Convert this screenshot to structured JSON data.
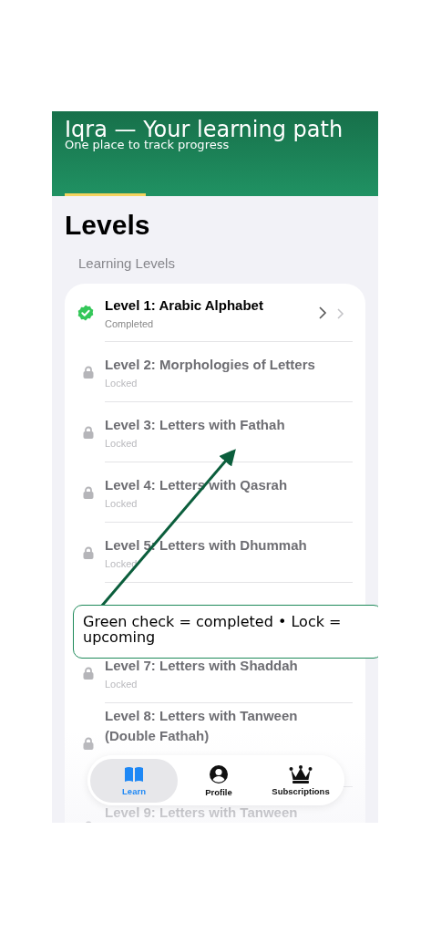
{
  "header": {
    "title": "Iqra — Your learning path",
    "subtitle": "One place to track progress"
  },
  "heading": "Levels",
  "section_label": "Learning Levels",
  "levels": [
    {
      "kind": "completed",
      "title": "Level 1: Arabic Alphabet",
      "status": "Completed"
    },
    {
      "kind": "locked",
      "title": "Level 2: Morphologies of Letters",
      "status": "Locked"
    },
    {
      "kind": "locked",
      "title": "Level 3: Letters with Fathah",
      "status": "Locked"
    },
    {
      "kind": "locked",
      "title": "Level 4: Letters with Qasrah",
      "status": "Locked"
    },
    {
      "kind": "locked",
      "title": "Level 5: Letters with Dhummah",
      "status": "Locked"
    },
    {
      "kind": "covered"
    },
    {
      "kind": "locked",
      "title": "Level 7: Letters with Shaddah",
      "status": "Locked"
    },
    {
      "kind": "locked",
      "title": "Level 8: Letters with Tanween (Double Fathah)"
    },
    {
      "kind": "locked",
      "title": "Level 9: Letters with Tanween"
    }
  ],
  "tab_bar": [
    {
      "kind": "book",
      "label": "Learn",
      "selected": true
    },
    {
      "kind": "person",
      "label": "Profile",
      "selected": false
    },
    {
      "kind": "crown",
      "label": "Subscriptions",
      "selected": false
    }
  ],
  "callout": {
    "text": "Green check = completed • Lock = upcoming"
  }
}
